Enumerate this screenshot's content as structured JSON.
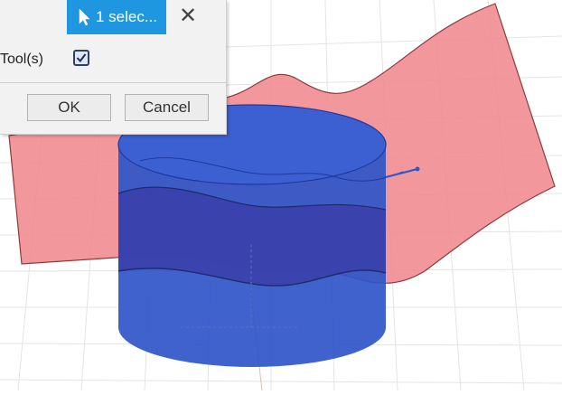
{
  "dialog": {
    "selection_label": "1 selec...",
    "close_symbol": "✕",
    "tool_label": "Tool(s)",
    "tool_checked": true,
    "ok_label": "OK",
    "cancel_label": "Cancel"
  },
  "viewport": {
    "surface_color": "#f08a8f",
    "body_color": "#2f55c9",
    "grid_color": "#e2e2e2"
  },
  "icons": [
    "cursor-arrow-icon",
    "close-icon",
    "checkmark-icon"
  ]
}
